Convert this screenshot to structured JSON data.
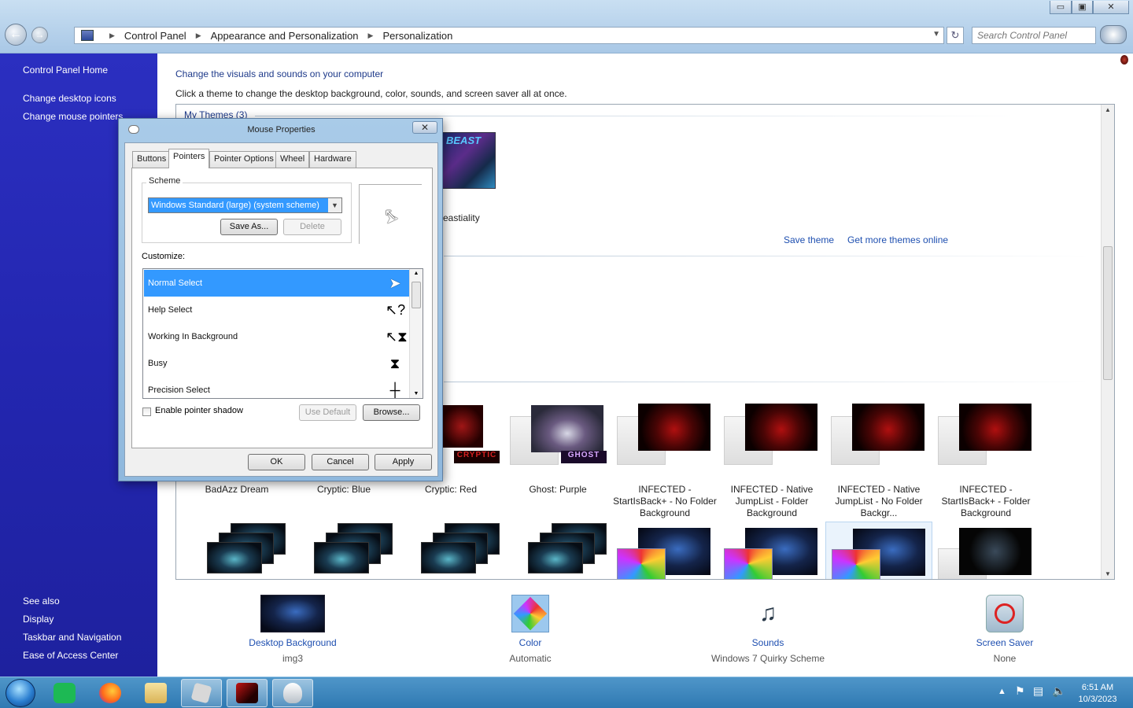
{
  "window": {
    "minimize": "▭",
    "maximize": "▣",
    "close": "✕"
  },
  "address": {
    "parts": [
      "Control Panel",
      "Appearance and Personalization",
      "Personalization"
    ],
    "search_placeholder": "Search Control Panel"
  },
  "sidebar": {
    "home": "Control Panel Home",
    "links": [
      "Change desktop icons",
      "Change mouse pointers"
    ],
    "see_also_title": "See also",
    "see_also": [
      "Display",
      "Taskbar and Navigation",
      "Ease of Access Center"
    ]
  },
  "main": {
    "title": "Change the visuals and sounds on your computer",
    "description": "Click a theme to change the desktop background, color, sounds, and screen saver all at once.",
    "my_themes": "My Themes (3)",
    "first_theme_name": "eastiality",
    "save_theme": "Save theme",
    "get_more": "Get more themes online",
    "themes_row": [
      {
        "name": "BadAzz Dream"
      },
      {
        "name": "Cryptic: Blue"
      },
      {
        "name": "Cryptic: Red"
      },
      {
        "name": "Ghost: Purple"
      },
      {
        "name": "INFECTED - StartIsBack+ - No Folder Background"
      },
      {
        "name": "INFECTED - Native JumpList - Folder Background"
      },
      {
        "name": "INFECTED - Native JumpList - No Folder Backgr..."
      },
      {
        "name": "INFECTED - StartIsBack+ - Folder Background"
      }
    ],
    "cryptic_label": "CRYPTIC",
    "ghost_label": "GHOST"
  },
  "bottom": {
    "desktop_background": {
      "label": "Desktop Background",
      "value": "img3"
    },
    "color": {
      "label": "Color",
      "value": "Automatic"
    },
    "sounds": {
      "label": "Sounds",
      "value": "Windows 7 Quirky Scheme"
    },
    "screen_saver": {
      "label": "Screen Saver",
      "value": "None"
    }
  },
  "dialog": {
    "title": "Mouse Properties",
    "close": "✕",
    "tabs": [
      "Buttons",
      "Pointers",
      "Pointer Options",
      "Wheel",
      "Hardware"
    ],
    "active_tab": "Pointers",
    "scheme_label": "Scheme",
    "scheme_value": "Windows Standard (large) (system scheme)",
    "save_as": "Save As...",
    "delete": "Delete",
    "customize_label": "Customize:",
    "pointers": [
      {
        "name": "Normal Select",
        "icon": "arrow-cursor-icon",
        "glyph": "➤"
      },
      {
        "name": "Help Select",
        "icon": "help-cursor-icon",
        "glyph": "↖?"
      },
      {
        "name": "Working In Background",
        "icon": "working-cursor-icon",
        "glyph": "↖⧗"
      },
      {
        "name": "Busy",
        "icon": "hourglass-icon",
        "glyph": "⧗"
      },
      {
        "name": "Precision Select",
        "icon": "crosshair-icon",
        "glyph": "┼"
      }
    ],
    "enable_shadow": "Enable pointer shadow",
    "use_default": "Use Default",
    "browse": "Browse...",
    "ok": "OK",
    "cancel": "Cancel",
    "apply": "Apply"
  },
  "taskbar": {
    "time": "6:51 AM",
    "date": "10/3/2023"
  },
  "colors": {
    "sidebar": "#2326b0",
    "link": "#1e4fb0",
    "selection": "#3399ff",
    "taskbar": "#3a84bd"
  }
}
